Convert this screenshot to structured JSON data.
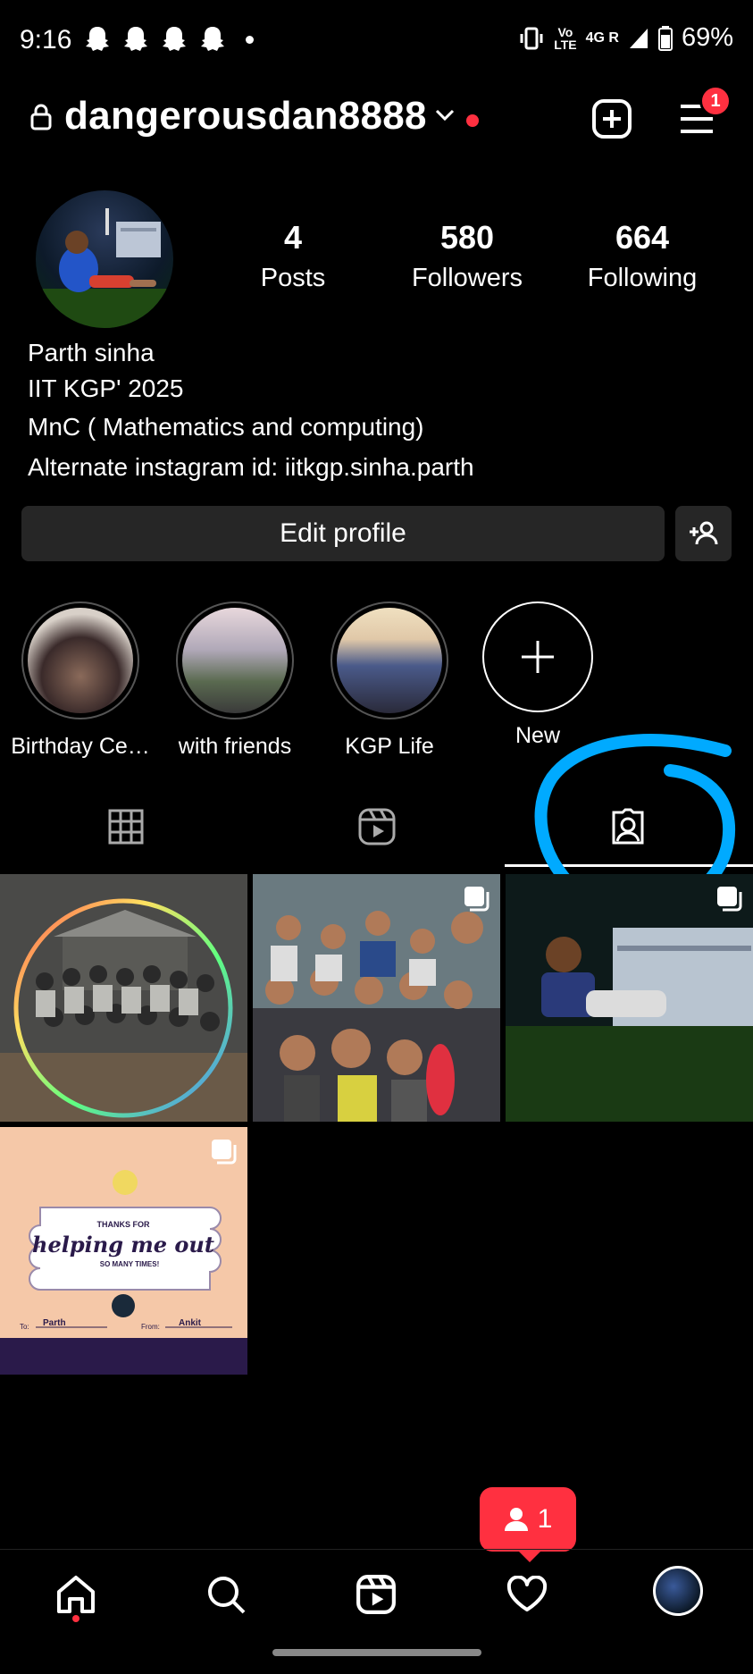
{
  "status_bar": {
    "time": "9:16",
    "network_top": "Vo",
    "network_mid": "LTE",
    "network_type": "4G R",
    "battery": "69%"
  },
  "header": {
    "username": "dangerousdan8888",
    "menu_badge": "1"
  },
  "profile": {
    "stats": [
      {
        "value": "4",
        "label": "Posts"
      },
      {
        "value": "580",
        "label": "Followers"
      },
      {
        "value": "664",
        "label": "Following"
      }
    ],
    "name": "Parth sinha",
    "bio_lines": [
      "IIT KGP' 2025",
      "MnC ( Mathematics and computing)",
      "Alternate instagram id: iitkgp.sinha.parth"
    ]
  },
  "actions": {
    "edit_profile": "Edit profile"
  },
  "highlights": [
    {
      "label": "Birthday Ce…"
    },
    {
      "label": "with friends"
    },
    {
      "label": "KGP Life"
    },
    {
      "label": "New"
    }
  ],
  "tabs": [
    "grid",
    "reels",
    "tagged"
  ],
  "active_tab": "tagged",
  "grid_post_texts": {
    "thanks_for": "THANKS FOR",
    "helping": "helping me out",
    "so_many": "SO MANY TIMES!",
    "to_label": "To:",
    "to_name": "Parth",
    "from_label": "From:",
    "from_name": "Ankit"
  },
  "notification": {
    "count": "1"
  },
  "colors": {
    "accent_red": "#ff3040",
    "annotation_blue": "#00aaff",
    "button_bg": "#262626"
  }
}
